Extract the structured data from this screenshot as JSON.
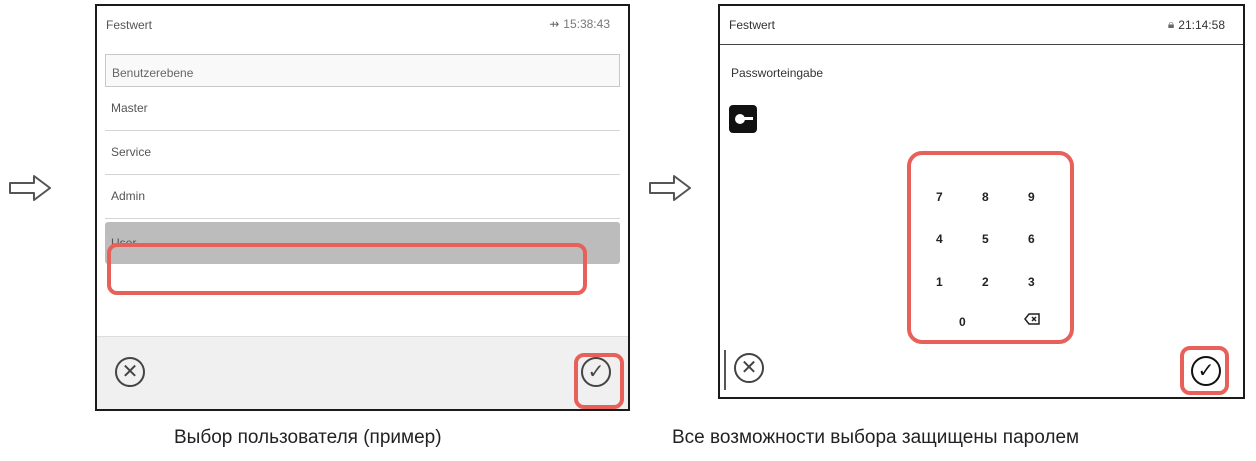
{
  "screen1": {
    "title": "Festwert",
    "status_time": "15:38:43",
    "list_header": "Benutzerebene",
    "items": [
      "Master",
      "Service",
      "Admin",
      "User"
    ],
    "selected_index": 3
  },
  "screen2": {
    "title": "Festwert",
    "status_time": "21:14:58",
    "password_label": "Passworteingabe",
    "keys": [
      "7",
      "8",
      "9",
      "4",
      "5",
      "6",
      "1",
      "2",
      "3",
      "0"
    ]
  },
  "icons": {
    "arrow": "right-arrow-icon",
    "cancel": "cancel-icon",
    "confirm": "checkmark-icon",
    "key": "key-icon",
    "backspace": "backspace-icon",
    "usb": "usb-icon",
    "lock": "lock-icon"
  },
  "colors": {
    "highlight": "#e8605a",
    "selected_row": "#bcbcbc"
  },
  "captions": {
    "left": "Выбор пользователя (пример)",
    "right": "Все возможности выбора защищены паролем"
  }
}
